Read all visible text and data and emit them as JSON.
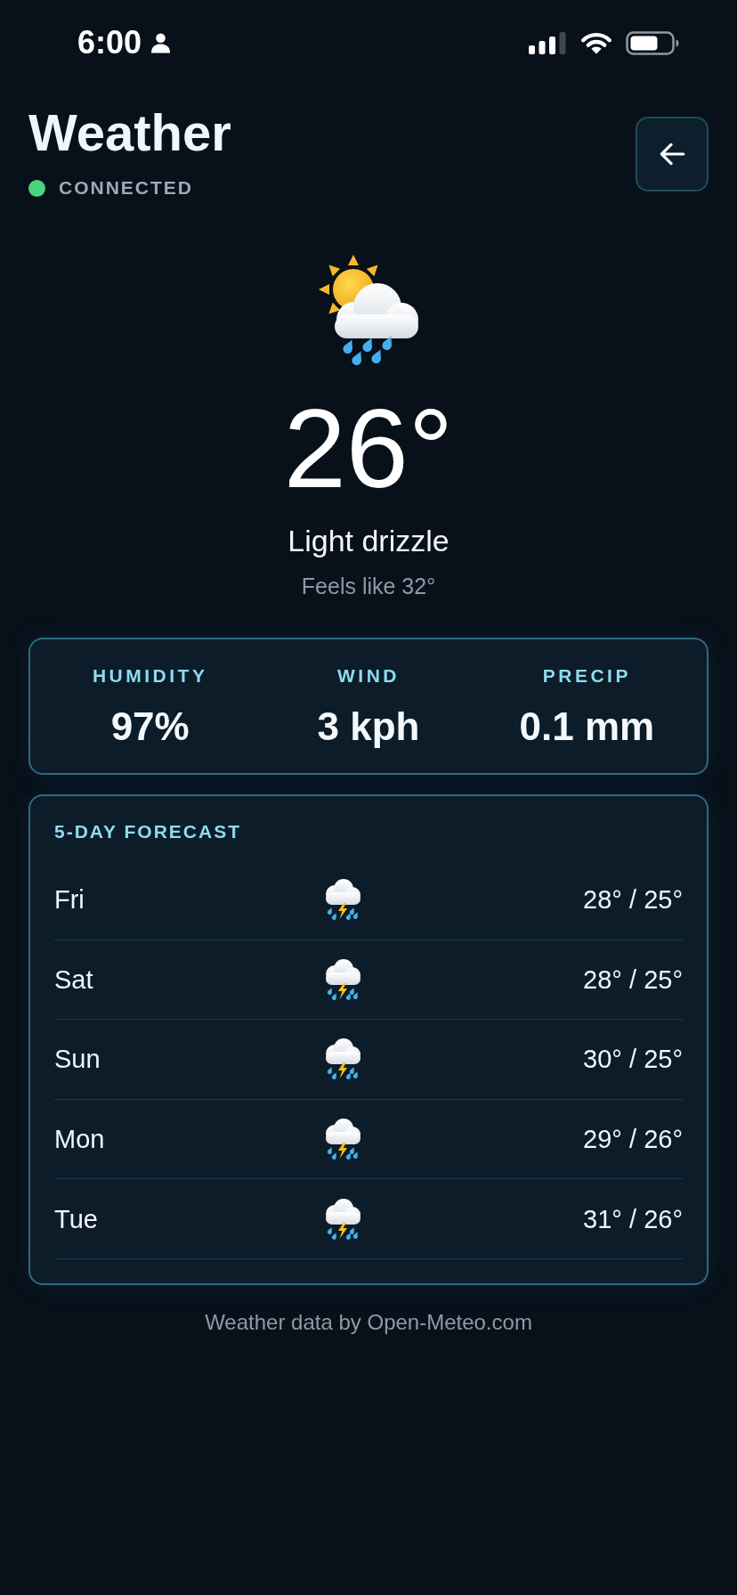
{
  "status_bar": {
    "time": "6:00"
  },
  "header": {
    "title": "Weather",
    "connected": true,
    "status": "CONNECTED"
  },
  "current": {
    "temperature": "26°",
    "condition": "Light drizzle",
    "feels_like": "Feels like 32°"
  },
  "stats": [
    {
      "label": "HUMIDITY",
      "value": "97%"
    },
    {
      "label": "WIND",
      "value": "3 kph"
    },
    {
      "label": "PRECIP",
      "value": "0.1 mm"
    }
  ],
  "forecast": {
    "title": "5-DAY FORECAST",
    "days": [
      {
        "day": "Fri",
        "range": "28° / 25°"
      },
      {
        "day": "Sat",
        "range": "28° / 25°"
      },
      {
        "day": "Sun",
        "range": "30° / 25°"
      },
      {
        "day": "Mon",
        "range": "29° / 26°"
      },
      {
        "day": "Tue",
        "range": "31° / 26°"
      }
    ]
  },
  "footer": "Weather data by Open-Meteo.com"
}
